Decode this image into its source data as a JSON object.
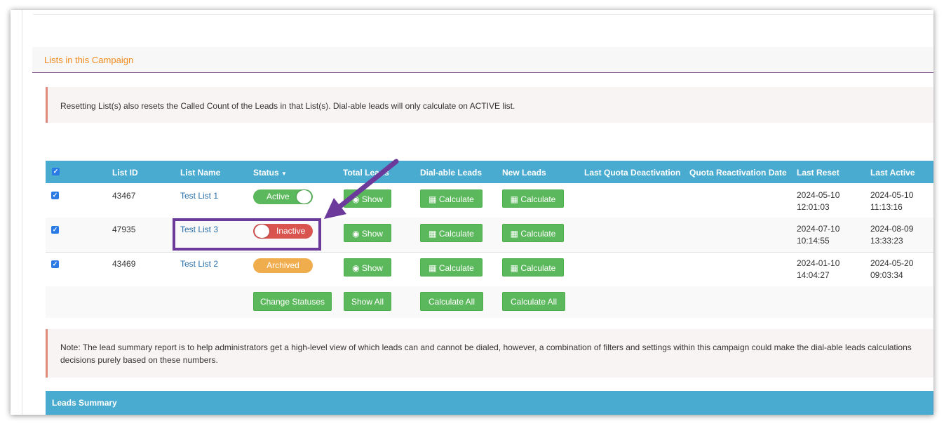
{
  "panel": {
    "title": "Lists in this Campaign"
  },
  "alerts": {
    "reset_note": "Resetting List(s) also resets the Called Count of the Leads in that List(s). Dial-able leads will only calculate on ACTIVE list.",
    "summary_note_line1": "Note: The lead summary report is to help administrators get a high-level view of which leads can and cannot be dialed, however, a combination of filters and settings within this campaign could make the dial-able leads calculations",
    "summary_note_line2": "decisions purely based on these numbers."
  },
  "table": {
    "headers": {
      "list_id": "List ID",
      "list_name": "List Name",
      "status": "Status",
      "total_leads": "Total Leads",
      "dialable_leads": "Dial-able Leads",
      "new_leads": "New Leads",
      "last_quota_deactivation": "Last Quota Deactivation",
      "quota_reactivation_date": "Quota Reactivation Date",
      "last_reset": "Last Reset",
      "last_active": "Last Active"
    },
    "rows": [
      {
        "id": "43467",
        "name": "Test List 1",
        "status": "Active",
        "show": "Show",
        "calc1": "Calculate",
        "calc2": "Calculate",
        "last_reset_date": "2024-05-10",
        "last_reset_time": "12:01:03",
        "last_active_date": "2024-05-10",
        "last_active_time": "11:13:16"
      },
      {
        "id": "47935",
        "name": "Test List 3",
        "status": "Inactive",
        "show": "Show",
        "calc1": "Calculate",
        "calc2": "Calculate",
        "last_reset_date": "2024-07-10",
        "last_reset_time": "10:14:55",
        "last_active_date": "2024-08-09",
        "last_active_time": "13:33:23"
      },
      {
        "id": "43469",
        "name": "Test List 2",
        "status": "Archived",
        "show": "Show",
        "calc1": "Calculate",
        "calc2": "Calculate",
        "last_reset_date": "2024-01-10",
        "last_reset_time": "14:04:27",
        "last_active_date": "2024-05-20",
        "last_active_time": "09:03:34"
      }
    ],
    "footer": {
      "change_statuses": "Change Statuses",
      "show_all": "Show All",
      "calculate_all_1": "Calculate All",
      "calculate_all_2": "Calculate All"
    }
  },
  "leads_summary": {
    "title": "Leads Summary"
  },
  "colors": {
    "header_blue": "#4aabd1",
    "button_green": "#5cb85c",
    "active_green": "#5cb85c",
    "inactive_red": "#d9534f",
    "archived_orange": "#f0ad4e",
    "annotation_purple": "#6b3a9b",
    "title_orange": "#f08a1c"
  },
  "icons": [
    "check-icon",
    "caret-down-icon",
    "eye-icon",
    "calculator-icon",
    "arrow-annotation"
  ]
}
